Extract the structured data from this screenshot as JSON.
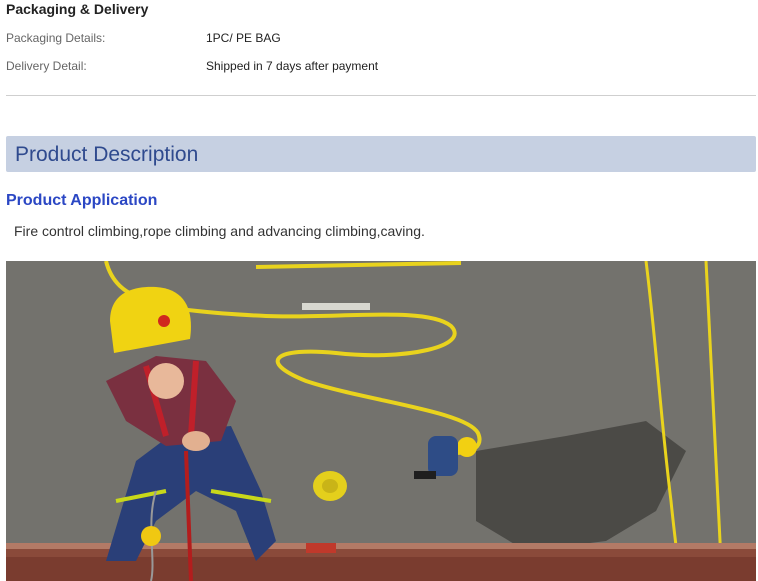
{
  "packaging": {
    "title": "Packaging & Delivery",
    "details_label": "Packaging Details:",
    "details_value": "1PC/ PE BAG",
    "delivery_label": "Delivery Detail:",
    "delivery_value": "Shipped in 7 days after payment"
  },
  "description": {
    "banner": "Product Description",
    "application_title": "Product Application",
    "application_text": "Fire control climbing,rope climbing and advancing climbing,caving."
  },
  "photo": {
    "subject": "firefighter-rope-climbing-photo"
  },
  "colors": {
    "banner_bg": "#c6d0e2",
    "banner_text": "#2f4a8e",
    "application_title": "#2b47c4"
  }
}
